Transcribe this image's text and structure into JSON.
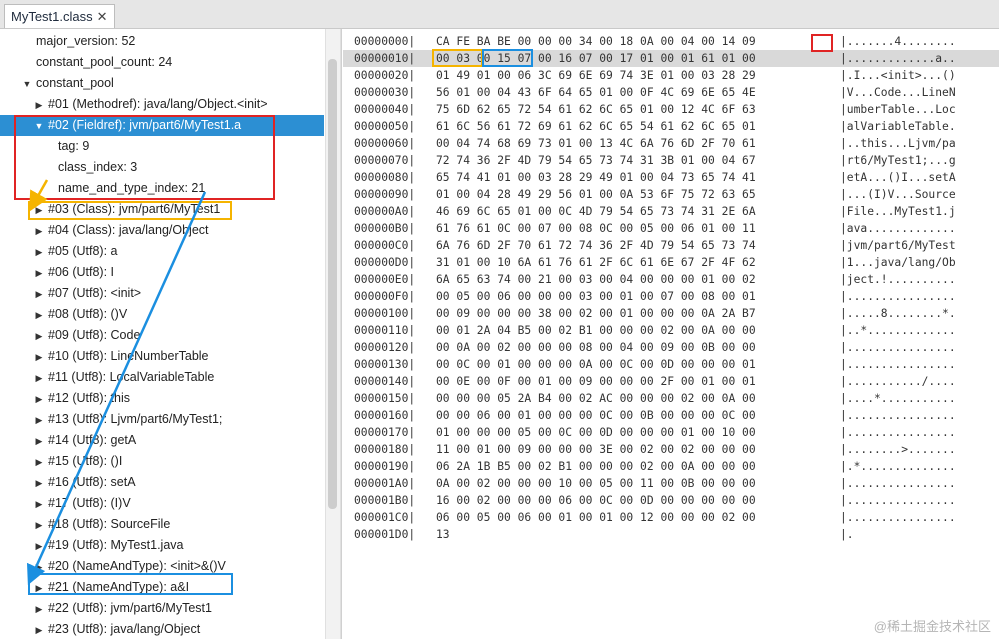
{
  "tab": {
    "title": "MyTest1.class",
    "close": "✕"
  },
  "tree": [
    {
      "indent": 36,
      "arrow": "",
      "label": "major_version: 52"
    },
    {
      "indent": 36,
      "arrow": "",
      "label": "constant_pool_count: 24"
    },
    {
      "indent": 22,
      "arrow": "▼",
      "label": "constant_pool"
    },
    {
      "indent": 34,
      "arrow": "▶",
      "label": "#01 (Methodref): java/lang/Object.<init>"
    },
    {
      "indent": 34,
      "arrow": "▼",
      "label": "#02 (Fieldref): jvm/part6/MyTest1.a",
      "selected": true
    },
    {
      "indent": 58,
      "arrow": "",
      "label": "tag: 9"
    },
    {
      "indent": 58,
      "arrow": "",
      "label": "class_index: 3"
    },
    {
      "indent": 58,
      "arrow": "",
      "label": "name_and_type_index: 21"
    },
    {
      "indent": 34,
      "arrow": "▶",
      "label": "#03 (Class): jvm/part6/MyTest1"
    },
    {
      "indent": 34,
      "arrow": "▶",
      "label": "#04 (Class): java/lang/Object"
    },
    {
      "indent": 34,
      "arrow": "▶",
      "label": "#05 (Utf8): a"
    },
    {
      "indent": 34,
      "arrow": "▶",
      "label": "#06 (Utf8): I"
    },
    {
      "indent": 34,
      "arrow": "▶",
      "label": "#07 (Utf8): <init>"
    },
    {
      "indent": 34,
      "arrow": "▶",
      "label": "#08 (Utf8): ()V"
    },
    {
      "indent": 34,
      "arrow": "▶",
      "label": "#09 (Utf8): Code"
    },
    {
      "indent": 34,
      "arrow": "▶",
      "label": "#10 (Utf8): LineNumberTable"
    },
    {
      "indent": 34,
      "arrow": "▶",
      "label": "#11 (Utf8): LocalVariableTable"
    },
    {
      "indent": 34,
      "arrow": "▶",
      "label": "#12 (Utf8): this"
    },
    {
      "indent": 34,
      "arrow": "▶",
      "label": "#13 (Utf8): Ljvm/part6/MyTest1;"
    },
    {
      "indent": 34,
      "arrow": "▶",
      "label": "#14 (Utf8): getA"
    },
    {
      "indent": 34,
      "arrow": "▶",
      "label": "#15 (Utf8): ()I"
    },
    {
      "indent": 34,
      "arrow": "▶",
      "label": "#16 (Utf8): setA"
    },
    {
      "indent": 34,
      "arrow": "▶",
      "label": "#17 (Utf8): (I)V"
    },
    {
      "indent": 34,
      "arrow": "▶",
      "label": "#18 (Utf8): SourceFile"
    },
    {
      "indent": 34,
      "arrow": "▶",
      "label": "#19 (Utf8): MyTest1.java"
    },
    {
      "indent": 34,
      "arrow": "▶",
      "label": "#20 (NameAndType): <init>&()V"
    },
    {
      "indent": 34,
      "arrow": "▶",
      "label": "#21 (NameAndType): a&I"
    },
    {
      "indent": 34,
      "arrow": "▶",
      "label": "#22 (Utf8): jvm/part6/MyTest1"
    },
    {
      "indent": 34,
      "arrow": "▶",
      "label": "#23 (Utf8): java/lang/Object"
    }
  ],
  "hex": [
    {
      "addr": "00000000|",
      "bytes": "CA FE BA BE 00 00 00 34 00 18 0A 00 04 00 14 09",
      "ascii": "|.......4........"
    },
    {
      "addr": "00000010|",
      "bytes": "00 03 00 15 07 00 16 07 00 17 01 00 01 61 01 00",
      "ascii": "|.............a..",
      "highlight": true
    },
    {
      "addr": "00000020|",
      "bytes": "01 49 01 00 06 3C 69 6E 69 74 3E 01 00 03 28 29",
      "ascii": "|.I...<init>...()"
    },
    {
      "addr": "00000030|",
      "bytes": "56 01 00 04 43 6F 64 65 01 00 0F 4C 69 6E 65 4E",
      "ascii": "|V...Code...LineN"
    },
    {
      "addr": "00000040|",
      "bytes": "75 6D 62 65 72 54 61 62 6C 65 01 00 12 4C 6F 63",
      "ascii": "|umberTable...Loc"
    },
    {
      "addr": "00000050|",
      "bytes": "61 6C 56 61 72 69 61 62 6C 65 54 61 62 6C 65 01",
      "ascii": "|alVariableTable."
    },
    {
      "addr": "00000060|",
      "bytes": "00 04 74 68 69 73 01 00 13 4C 6A 76 6D 2F 70 61",
      "ascii": "|..this...Ljvm/pa"
    },
    {
      "addr": "00000070|",
      "bytes": "72 74 36 2F 4D 79 54 65 73 74 31 3B 01 00 04 67",
      "ascii": "|rt6/MyTest1;...g"
    },
    {
      "addr": "00000080|",
      "bytes": "65 74 41 01 00 03 28 29 49 01 00 04 73 65 74 41",
      "ascii": "|etA...()I...setA"
    },
    {
      "addr": "00000090|",
      "bytes": "01 00 04 28 49 29 56 01 00 0A 53 6F 75 72 63 65",
      "ascii": "|...(I)V...Source"
    },
    {
      "addr": "000000A0|",
      "bytes": "46 69 6C 65 01 00 0C 4D 79 54 65 73 74 31 2E 6A",
      "ascii": "|File...MyTest1.j"
    },
    {
      "addr": "000000B0|",
      "bytes": "61 76 61 0C 00 07 00 08 0C 00 05 00 06 01 00 11",
      "ascii": "|ava............."
    },
    {
      "addr": "000000C0|",
      "bytes": "6A 76 6D 2F 70 61 72 74 36 2F 4D 79 54 65 73 74",
      "ascii": "|jvm/part6/MyTest"
    },
    {
      "addr": "000000D0|",
      "bytes": "31 01 00 10 6A 61 76 61 2F 6C 61 6E 67 2F 4F 62",
      "ascii": "|1...java/lang/Ob"
    },
    {
      "addr": "000000E0|",
      "bytes": "6A 65 63 74 00 21 00 03 00 04 00 00 00 01 00 02",
      "ascii": "|ject.!.........."
    },
    {
      "addr": "000000F0|",
      "bytes": "00 05 00 06 00 00 00 03 00 01 00 07 00 08 00 01",
      "ascii": "|................"
    },
    {
      "addr": "00000100|",
      "bytes": "00 09 00 00 00 38 00 02 00 01 00 00 00 0A 2A B7",
      "ascii": "|.....8........*."
    },
    {
      "addr": "00000110|",
      "bytes": "00 01 2A 04 B5 00 02 B1 00 00 00 02 00 0A 00 00",
      "ascii": "|..*............."
    },
    {
      "addr": "00000120|",
      "bytes": "00 0A 00 02 00 00 00 08 00 04 00 09 00 0B 00 00",
      "ascii": "|................"
    },
    {
      "addr": "00000130|",
      "bytes": "00 0C 00 01 00 00 00 0A 00 0C 00 0D 00 00 00 01",
      "ascii": "|................"
    },
    {
      "addr": "00000140|",
      "bytes": "00 0E 00 0F 00 01 00 09 00 00 00 2F 00 01 00 01",
      "ascii": "|.........../...."
    },
    {
      "addr": "00000150|",
      "bytes": "00 00 00 05 2A B4 00 02 AC 00 00 00 02 00 0A 00",
      "ascii": "|....*..........."
    },
    {
      "addr": "00000160|",
      "bytes": "00 00 06 00 01 00 00 00 0C 00 0B 00 00 00 0C 00",
      "ascii": "|................"
    },
    {
      "addr": "00000170|",
      "bytes": "01 00 00 00 05 00 0C 00 0D 00 00 00 01 00 10 00",
      "ascii": "|................"
    },
    {
      "addr": "00000180|",
      "bytes": "11 00 01 00 09 00 00 00 3E 00 02 00 02 00 00 00",
      "ascii": "|........>......."
    },
    {
      "addr": "00000190|",
      "bytes": "06 2A 1B B5 00 02 B1 00 00 00 02 00 0A 00 00 00",
      "ascii": "|.*.............."
    },
    {
      "addr": "000001A0|",
      "bytes": "0A 00 02 00 00 00 10 00 05 00 11 00 0B 00 00 00",
      "ascii": "|................"
    },
    {
      "addr": "000001B0|",
      "bytes": "16 00 02 00 00 00 06 00 0C 00 0D 00 00 00 00 00",
      "ascii": "|................"
    },
    {
      "addr": "000001C0|",
      "bytes": "06 00 05 00 06 00 01 00 01 00 12 00 00 00 02 00",
      "ascii": "|................"
    },
    {
      "addr": "000001D0|",
      "bytes": "13",
      "ascii": "|."
    }
  ],
  "watermark": "@稀土掘金技术社区",
  "colors": {
    "selection": "#2c8fd3",
    "red_box": "#e02424",
    "yellow_box": "#f5b400",
    "blue_box": "#1b8fe0",
    "row_highlight": "#d9d9d9"
  }
}
